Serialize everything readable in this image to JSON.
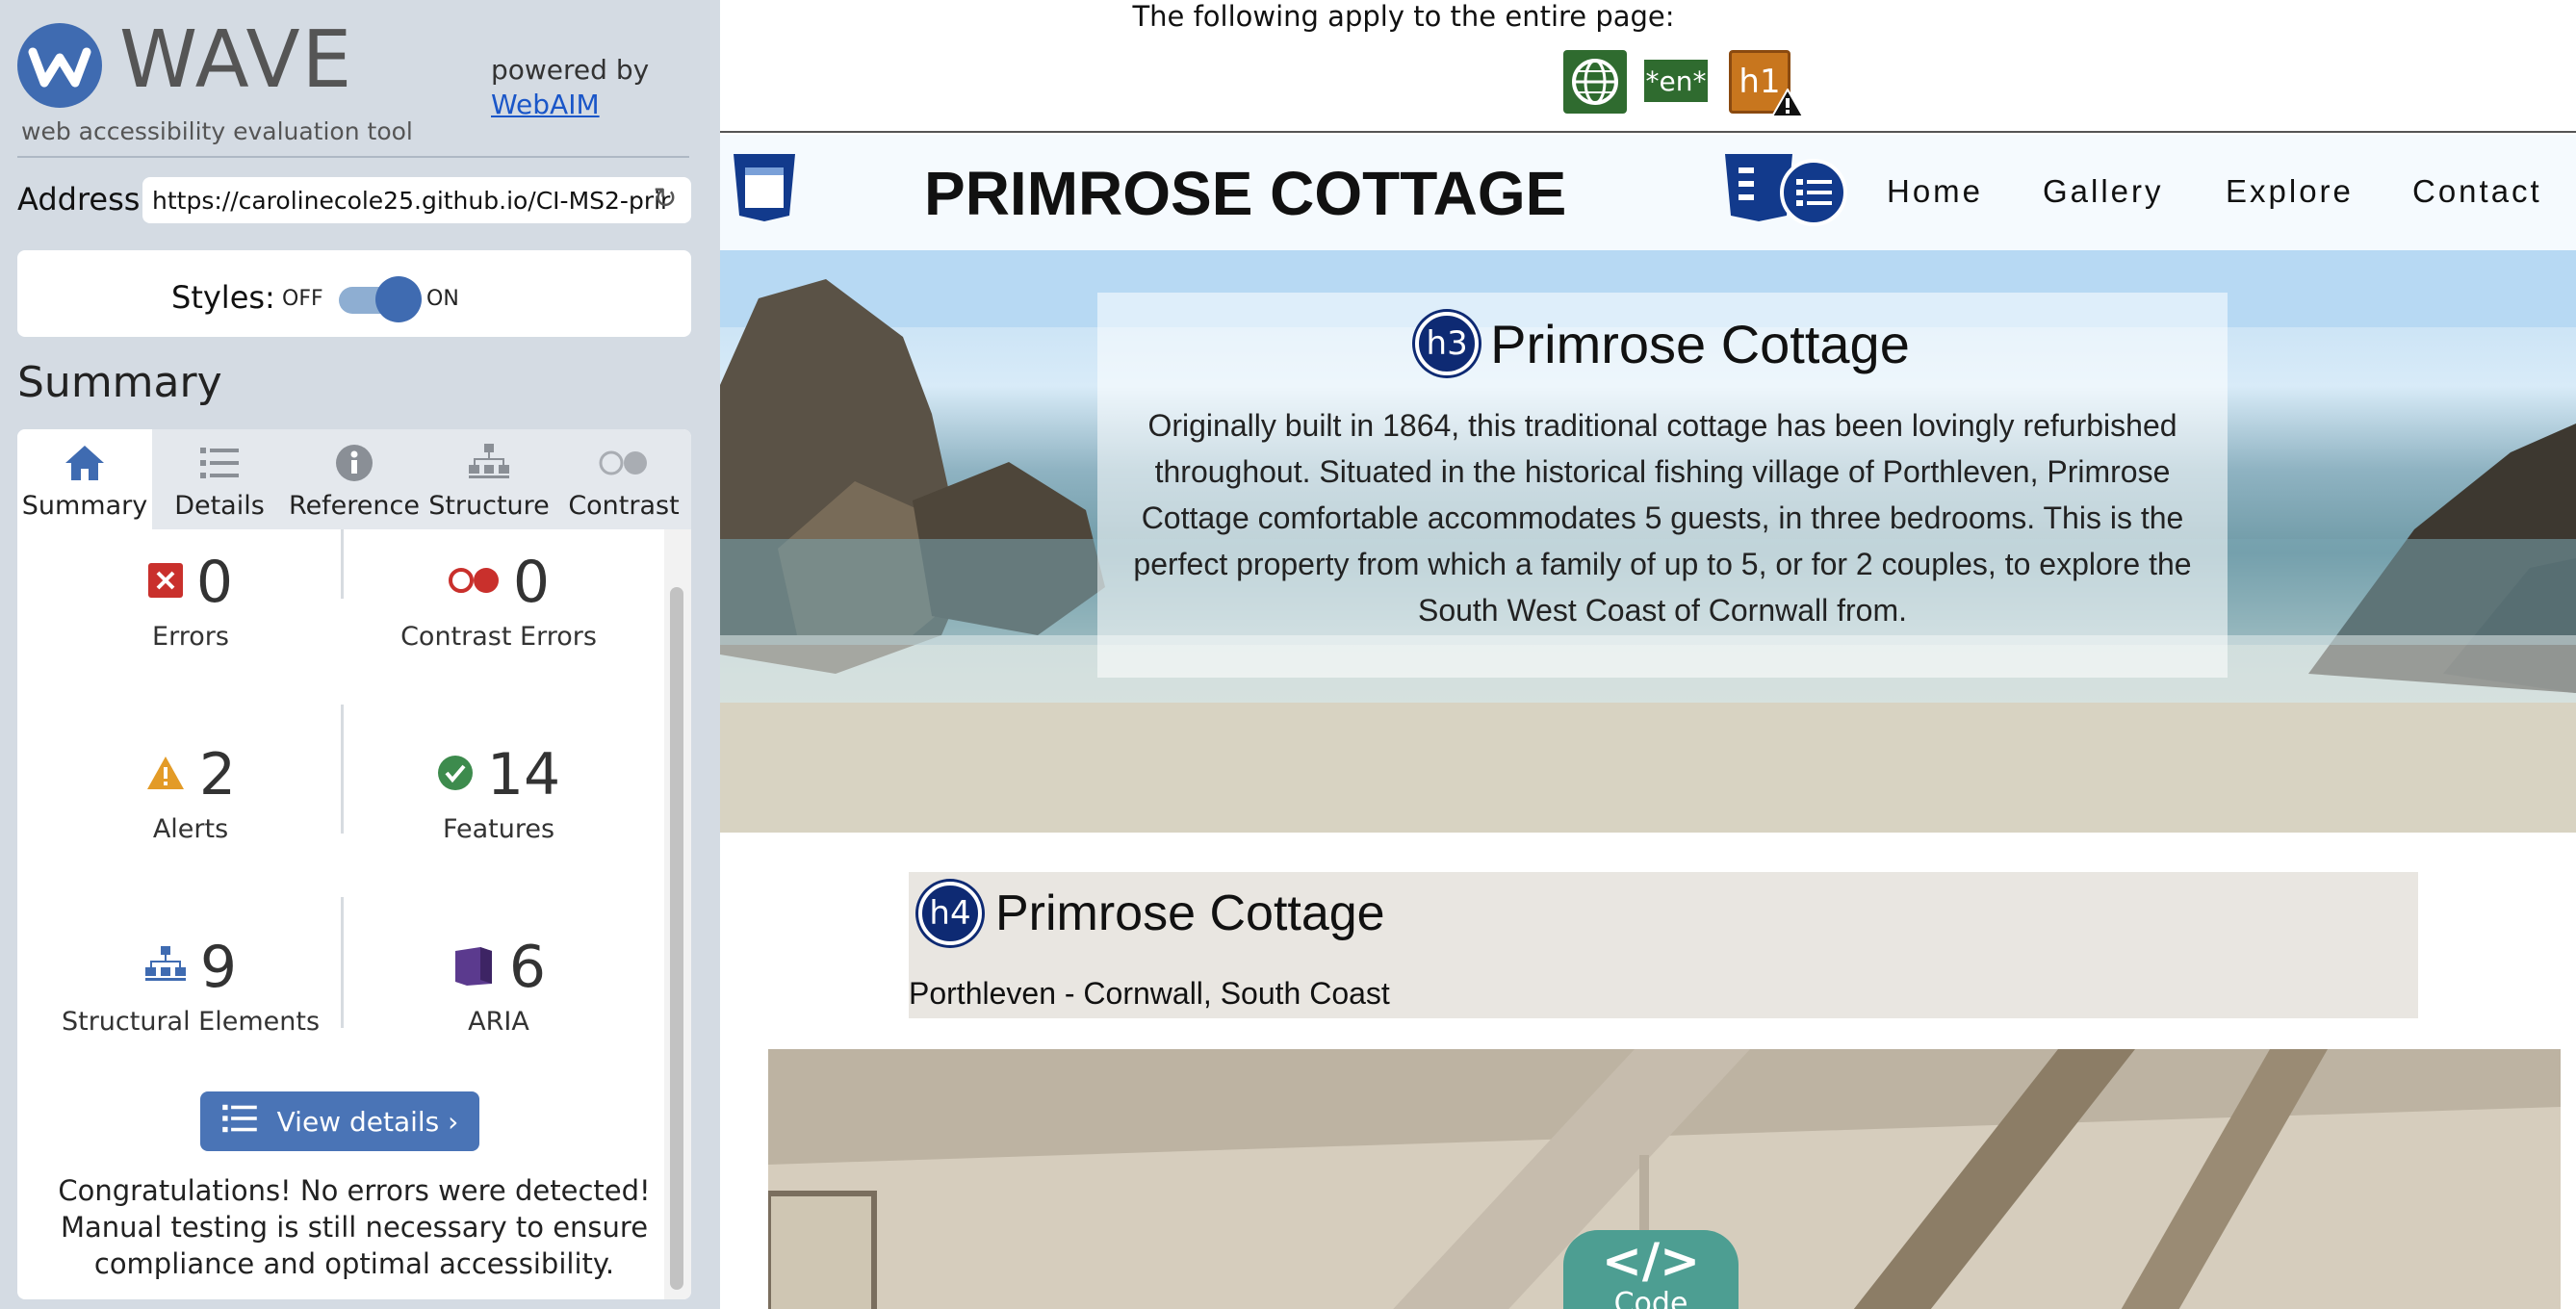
{
  "wave": {
    "logo_text": "WAVE",
    "tagline": "web accessibility evaluation tool",
    "powered_by": "powered by",
    "powered_link": "WebAIM",
    "address_label": "Address:",
    "address_value": "https://carolinecole25.github.io/CI-MS2-prir",
    "styles_label": "Styles:",
    "styles_off": "OFF",
    "styles_on": "ON",
    "summary_heading": "Summary",
    "tabs": [
      {
        "label": "Summary",
        "icon": "home-icon"
      },
      {
        "label": "Details",
        "icon": "list-icon"
      },
      {
        "label": "Reference",
        "icon": "info-icon"
      },
      {
        "label": "Structure",
        "icon": "hierarchy-icon"
      },
      {
        "label": "Contrast",
        "icon": "contrast-icon"
      }
    ],
    "stats": [
      {
        "value": "0",
        "label": "Errors",
        "icon": "error-icon",
        "color": "#c9302c"
      },
      {
        "value": "0",
        "label": "Contrast Errors",
        "icon": "contrast-error-icon",
        "color": "#c9302c"
      },
      {
        "value": "2",
        "label": "Alerts",
        "icon": "alert-icon",
        "color": "#e39b27"
      },
      {
        "value": "14",
        "label": "Features",
        "icon": "check-icon",
        "color": "#3d8b4d"
      },
      {
        "value": "9",
        "label": "Structural Elements",
        "icon": "structure-icon",
        "color": "#3f6bb1"
      },
      {
        "value": "6",
        "label": "ARIA",
        "icon": "aria-icon",
        "color": "#5b3a8e"
      }
    ],
    "view_details": "View details ›",
    "congrats": "Congratulations! No errors were detected! Manual testing is still necessary to ensure compliance and optimal accessibility."
  },
  "page": {
    "apply_text": "The following apply to the entire page:",
    "apply_icons": [
      "language-icon",
      "lang-en-badge",
      "h1-alert-badge"
    ],
    "lang_badge": "*en*",
    "h1_badge": "h1",
    "site_title": "PRIMROSE COTTAGE",
    "nav": [
      "Home",
      "Gallery",
      "Explore",
      "Contact"
    ],
    "hero_heading_level": "h3",
    "hero_title": "Primrose Cottage",
    "hero_text": "Originally built in 1864, this traditional cottage has been lovingly refurbished throughout. Situated in the historical fishing village of Porthleven, Primrose Cottage comfortable accommodates 5 guests, in three bedrooms. This is the perfect property from which a family of up to 5, or for 2 couples, to explore the South West Coast of Cornwall from.",
    "info_heading_level": "h4",
    "info_title": "Primrose Cottage",
    "info_subtitle": "Porthleven - Cornwall, South Coast",
    "code_glyph": "</>",
    "code_label": "Code"
  },
  "colors": {
    "wave_blue": "#3f6bb1",
    "sidebar_bg": "#d4dbe3",
    "heading_badge": "#0e2a73",
    "feature_green": "#2f6b2f",
    "alert_orange": "#c8761e",
    "code_teal": "#4d9e92"
  }
}
